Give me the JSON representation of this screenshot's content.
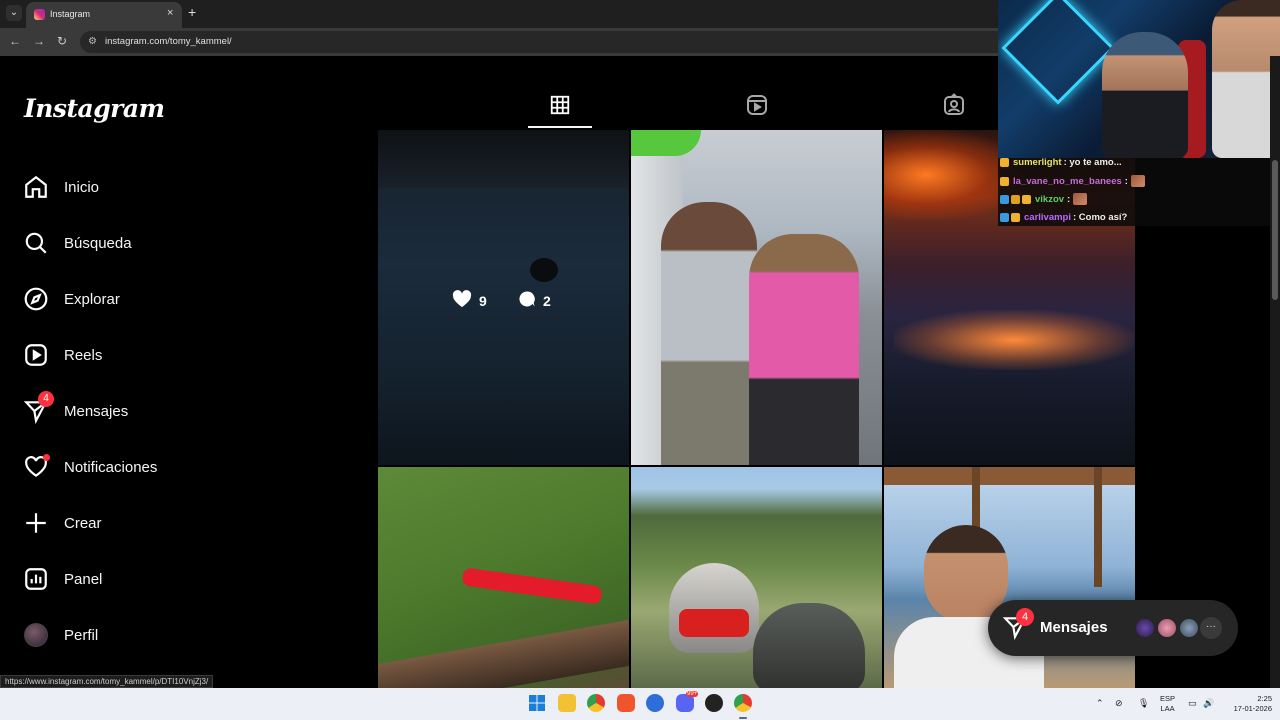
{
  "browser": {
    "tab_title": "Instagram",
    "tab_close": "×",
    "new_tab": "+",
    "url": "instagram.com/tomy_kammel/",
    "status_url": "https://www.instagram.com/tomy_kammel/p/DTI10VnjZj3/"
  },
  "sidebar": {
    "logo": "Instagram",
    "items": [
      {
        "label": "Inicio",
        "icon": "home-icon"
      },
      {
        "label": "Búsqueda",
        "icon": "search-icon"
      },
      {
        "label": "Explorar",
        "icon": "compass-icon"
      },
      {
        "label": "Reels",
        "icon": "reels-icon"
      },
      {
        "label": "Mensajes",
        "icon": "messenger-icon",
        "badge": "4"
      },
      {
        "label": "Notificaciones",
        "icon": "heart-icon"
      },
      {
        "label": "Crear",
        "icon": "plus-icon"
      },
      {
        "label": "Panel",
        "icon": "dashboard-icon"
      },
      {
        "label": "Perfil",
        "icon": "avatar"
      }
    ]
  },
  "profile_tabs": [
    "grid-icon",
    "reels-icon",
    "tagged-icon"
  ],
  "post_grid": {
    "hovered_post": {
      "likes": "9",
      "comments": "2"
    }
  },
  "messages_pill": {
    "label": "Mensajes",
    "badge": "4",
    "more": "···"
  },
  "stream_chat": [
    {
      "user": "sumerlight",
      "message": ": yo te amo...",
      "user_color": "#e8e46a"
    },
    {
      "user": "la_vane_no_me_banees",
      "message": ":",
      "user_color": "#c86ad8"
    },
    {
      "user": "vikzov",
      "message": ":",
      "user_color": "#5ad06a"
    },
    {
      "user": "carlivampi",
      "message": ": Como así?",
      "user_color": "#b86aff"
    }
  ],
  "taskbar": {
    "lang_top": "ESP",
    "lang_bottom": "LAA",
    "time": "2:25",
    "date": "17-01-2026",
    "tray_badge": "99+"
  },
  "colors": {
    "notification_red": "#ff3040",
    "background": "#000000"
  }
}
